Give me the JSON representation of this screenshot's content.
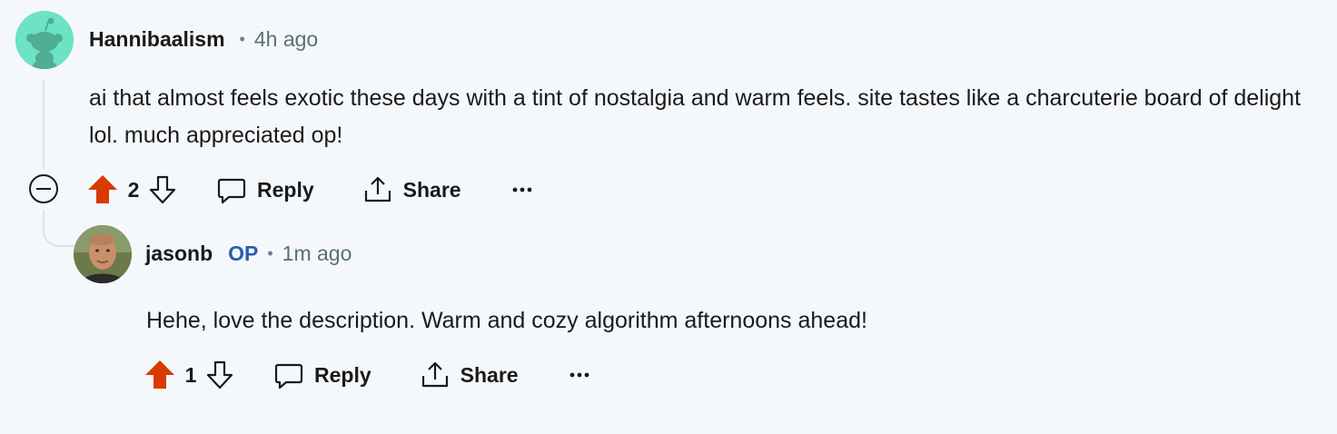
{
  "colors": {
    "background": "#f5f8fb",
    "upvote_active": "#d93a00",
    "op_badge": "#2a5db0",
    "thread_line": "#dbe4ea",
    "avatar_teal": "#6de2c4"
  },
  "comment": {
    "author": "Hannibaalism",
    "separator": "•",
    "time": "4h ago",
    "body": "ai that almost feels exotic these days with a tint of nostalgia and warm feels. site tastes like a charcuterie board of delight lol. much appreciated op!",
    "score": "2",
    "upvoted": true,
    "reply_label": "Reply",
    "share_label": "Share",
    "more_label": "•••",
    "avatar_icon": "snoo-avatar-icon",
    "collapse_icon": "collapse-minus-icon"
  },
  "reply": {
    "author": "jasonb",
    "badge": "OP",
    "separator": "•",
    "time": "1m ago",
    "body": "Hehe, love the description. Warm and cozy algorithm afternoons ahead!",
    "score": "1",
    "upvoted": true,
    "reply_label": "Reply",
    "share_label": "Share",
    "more_label": "•••",
    "avatar_icon": "user-photo-avatar"
  }
}
